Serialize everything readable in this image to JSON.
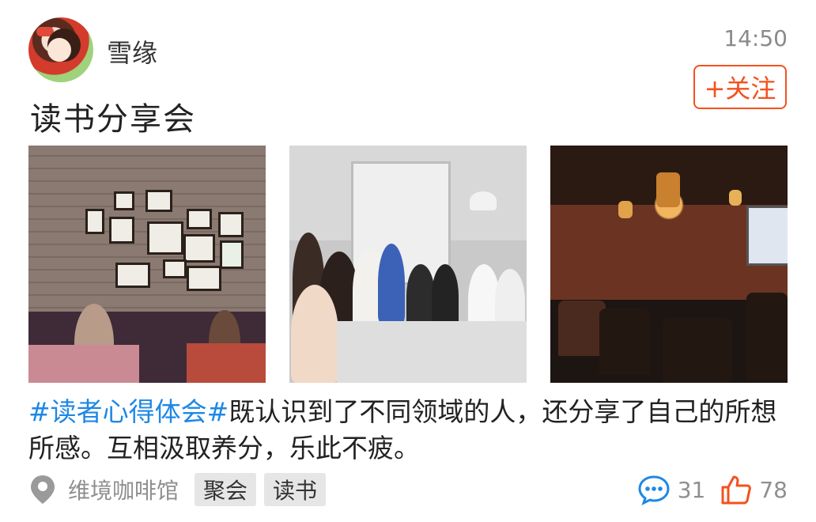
{
  "post": {
    "username": "雪缘",
    "time": "14:50",
    "follow_label": "+关注",
    "title": "读书分享会",
    "content": {
      "hashtag": "#读者心得体会#",
      "text": "既认识到了不同领域的人，还分享了自己的所想所感。互相汲取养分，乐此不疲。"
    },
    "location": "维境咖啡馆",
    "tags": [
      "聚会",
      "读书"
    ],
    "comment_count": "31",
    "like_count": "78"
  },
  "colors": {
    "accent": "#f4511e",
    "hashtag": "#1e88e5",
    "muted": "#8f8f8f"
  },
  "icons": {
    "location": "map-pin-icon",
    "comments": "speech-bubble-icon",
    "likes": "thumbs-up-icon"
  }
}
